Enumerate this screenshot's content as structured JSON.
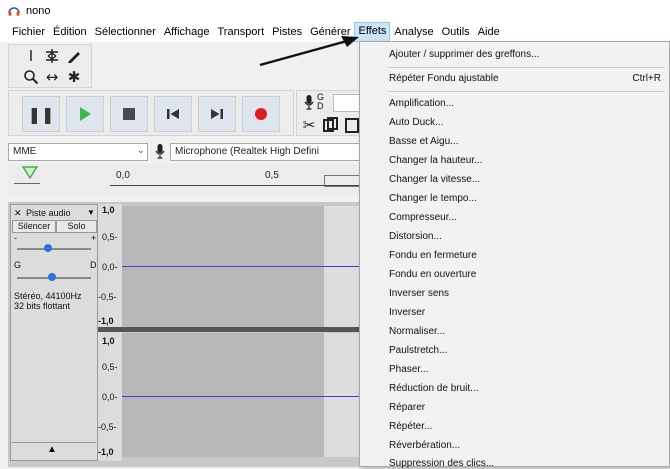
{
  "window": {
    "title": "nono"
  },
  "menubar": {
    "items": [
      "Fichier",
      "Édition",
      "Sélectionner",
      "Affichage",
      "Transport",
      "Pistes",
      "Générer",
      "Effets",
      "Analyse",
      "Outils",
      "Aide"
    ],
    "active": "Effets"
  },
  "device": {
    "host": "MME",
    "input": "Microphone (Realtek High Defini"
  },
  "toolbar": {
    "meter_labels": [
      "G",
      "D"
    ]
  },
  "timeline": {
    "labels": [
      "0,0",
      "0,5"
    ]
  },
  "track": {
    "name": "Piste audio",
    "mute": "Silencer",
    "solo": "Solo",
    "gain_minus": "-",
    "gain_plus": "+",
    "pan_left": "G",
    "pan_right": "D",
    "info_line1": "Stéréo, 44100Hz",
    "info_line2": "32 bits flottant",
    "scale_top": [
      "1,0",
      "0,5-",
      "0,0-",
      "-0,5-",
      "-1,0"
    ],
    "scale_bottom": [
      "1,0",
      "0,5-",
      "0,0-",
      "-0,5-",
      "-1,0"
    ]
  },
  "effects_menu": {
    "items": [
      {
        "label": "Ajouter / supprimer des greffons..."
      },
      {
        "label": "Répéter Fondu ajustable",
        "shortcut": "Ctrl+R"
      },
      {
        "label": "Amplification..."
      },
      {
        "label": "Auto Duck..."
      },
      {
        "label": "Basse et Aigu..."
      },
      {
        "label": "Changer la hauteur..."
      },
      {
        "label": "Changer la vitesse..."
      },
      {
        "label": "Changer le tempo..."
      },
      {
        "label": "Compresseur..."
      },
      {
        "label": "Distorsion..."
      },
      {
        "label": "Fondu en fermeture"
      },
      {
        "label": "Fondu en ouverture"
      },
      {
        "label": "Inverser sens"
      },
      {
        "label": "Inverser"
      },
      {
        "label": "Normaliser..."
      },
      {
        "label": "Paulstretch..."
      },
      {
        "label": "Phaser..."
      },
      {
        "label": "Réduction de bruit..."
      },
      {
        "label": "Réparer"
      },
      {
        "label": "Répéter..."
      },
      {
        "label": "Réverbération..."
      },
      {
        "label": "Suppression des clics..."
      }
    ]
  },
  "colors": {
    "menu_active_bg": "#cce4f7",
    "play_green": "#3dbb4a",
    "record_red": "#e01b24",
    "waveform_line": "#3844cc",
    "arrow": "#111111"
  }
}
